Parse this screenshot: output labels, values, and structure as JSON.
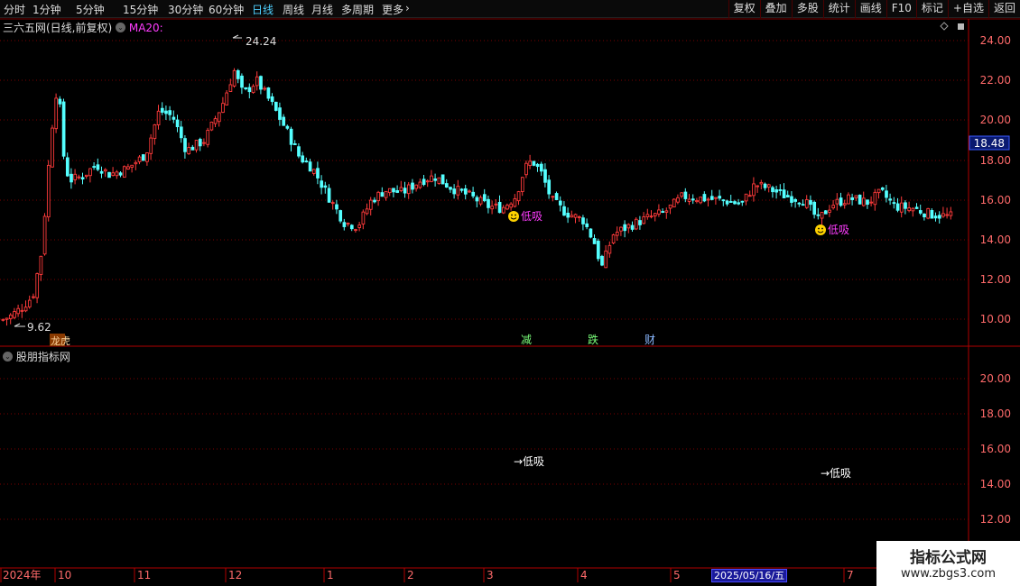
{
  "toolbar": {
    "timeframes": [
      "分时",
      "1分钟",
      "5分钟",
      "15分钟",
      "30分钟",
      "60分钟",
      "日线",
      "周线",
      "月线",
      "多周期",
      "更多"
    ],
    "active": "日线",
    "more_arrow": "›",
    "tools": [
      "复权",
      "叠加",
      "多股",
      "统计",
      "画线",
      "F10",
      "标记",
      "+自选",
      "返回"
    ]
  },
  "main_panel": {
    "title": "三六五网(日线,前复权)",
    "indicator": "MA20:",
    "indicator_color": "#ff3cff",
    "price_tag": "18.48",
    "high_label": "24.24",
    "low_label": "9.62",
    "signal_label": "低吸",
    "y_axis": [
      "24.00",
      "22.00",
      "20.00",
      "18.00",
      "16.00",
      "14.00",
      "12.00",
      "10.00"
    ],
    "event_tags": [
      "龙虎",
      "减",
      "跌",
      "财"
    ]
  },
  "sub_panel": {
    "title": "股朋指标网",
    "signal_texts": [
      "→低吸",
      "→低吸"
    ],
    "y_axis": [
      "20.00",
      "18.00",
      "16.00",
      "14.00",
      "12.00"
    ]
  },
  "time_axis": {
    "labels": [
      "2024年",
      "10",
      "11",
      "12",
      "1",
      "2",
      "3",
      "4",
      "5",
      "2025/05/16/五",
      "7"
    ]
  },
  "watermark": {
    "line1": "指标公式网",
    "line2": "www.zbgs3.com"
  },
  "colors": {
    "up": "#ff3b3b",
    "down": "#54ffff",
    "grid": "#7a0000",
    "signal": "#ff3cff"
  }
}
